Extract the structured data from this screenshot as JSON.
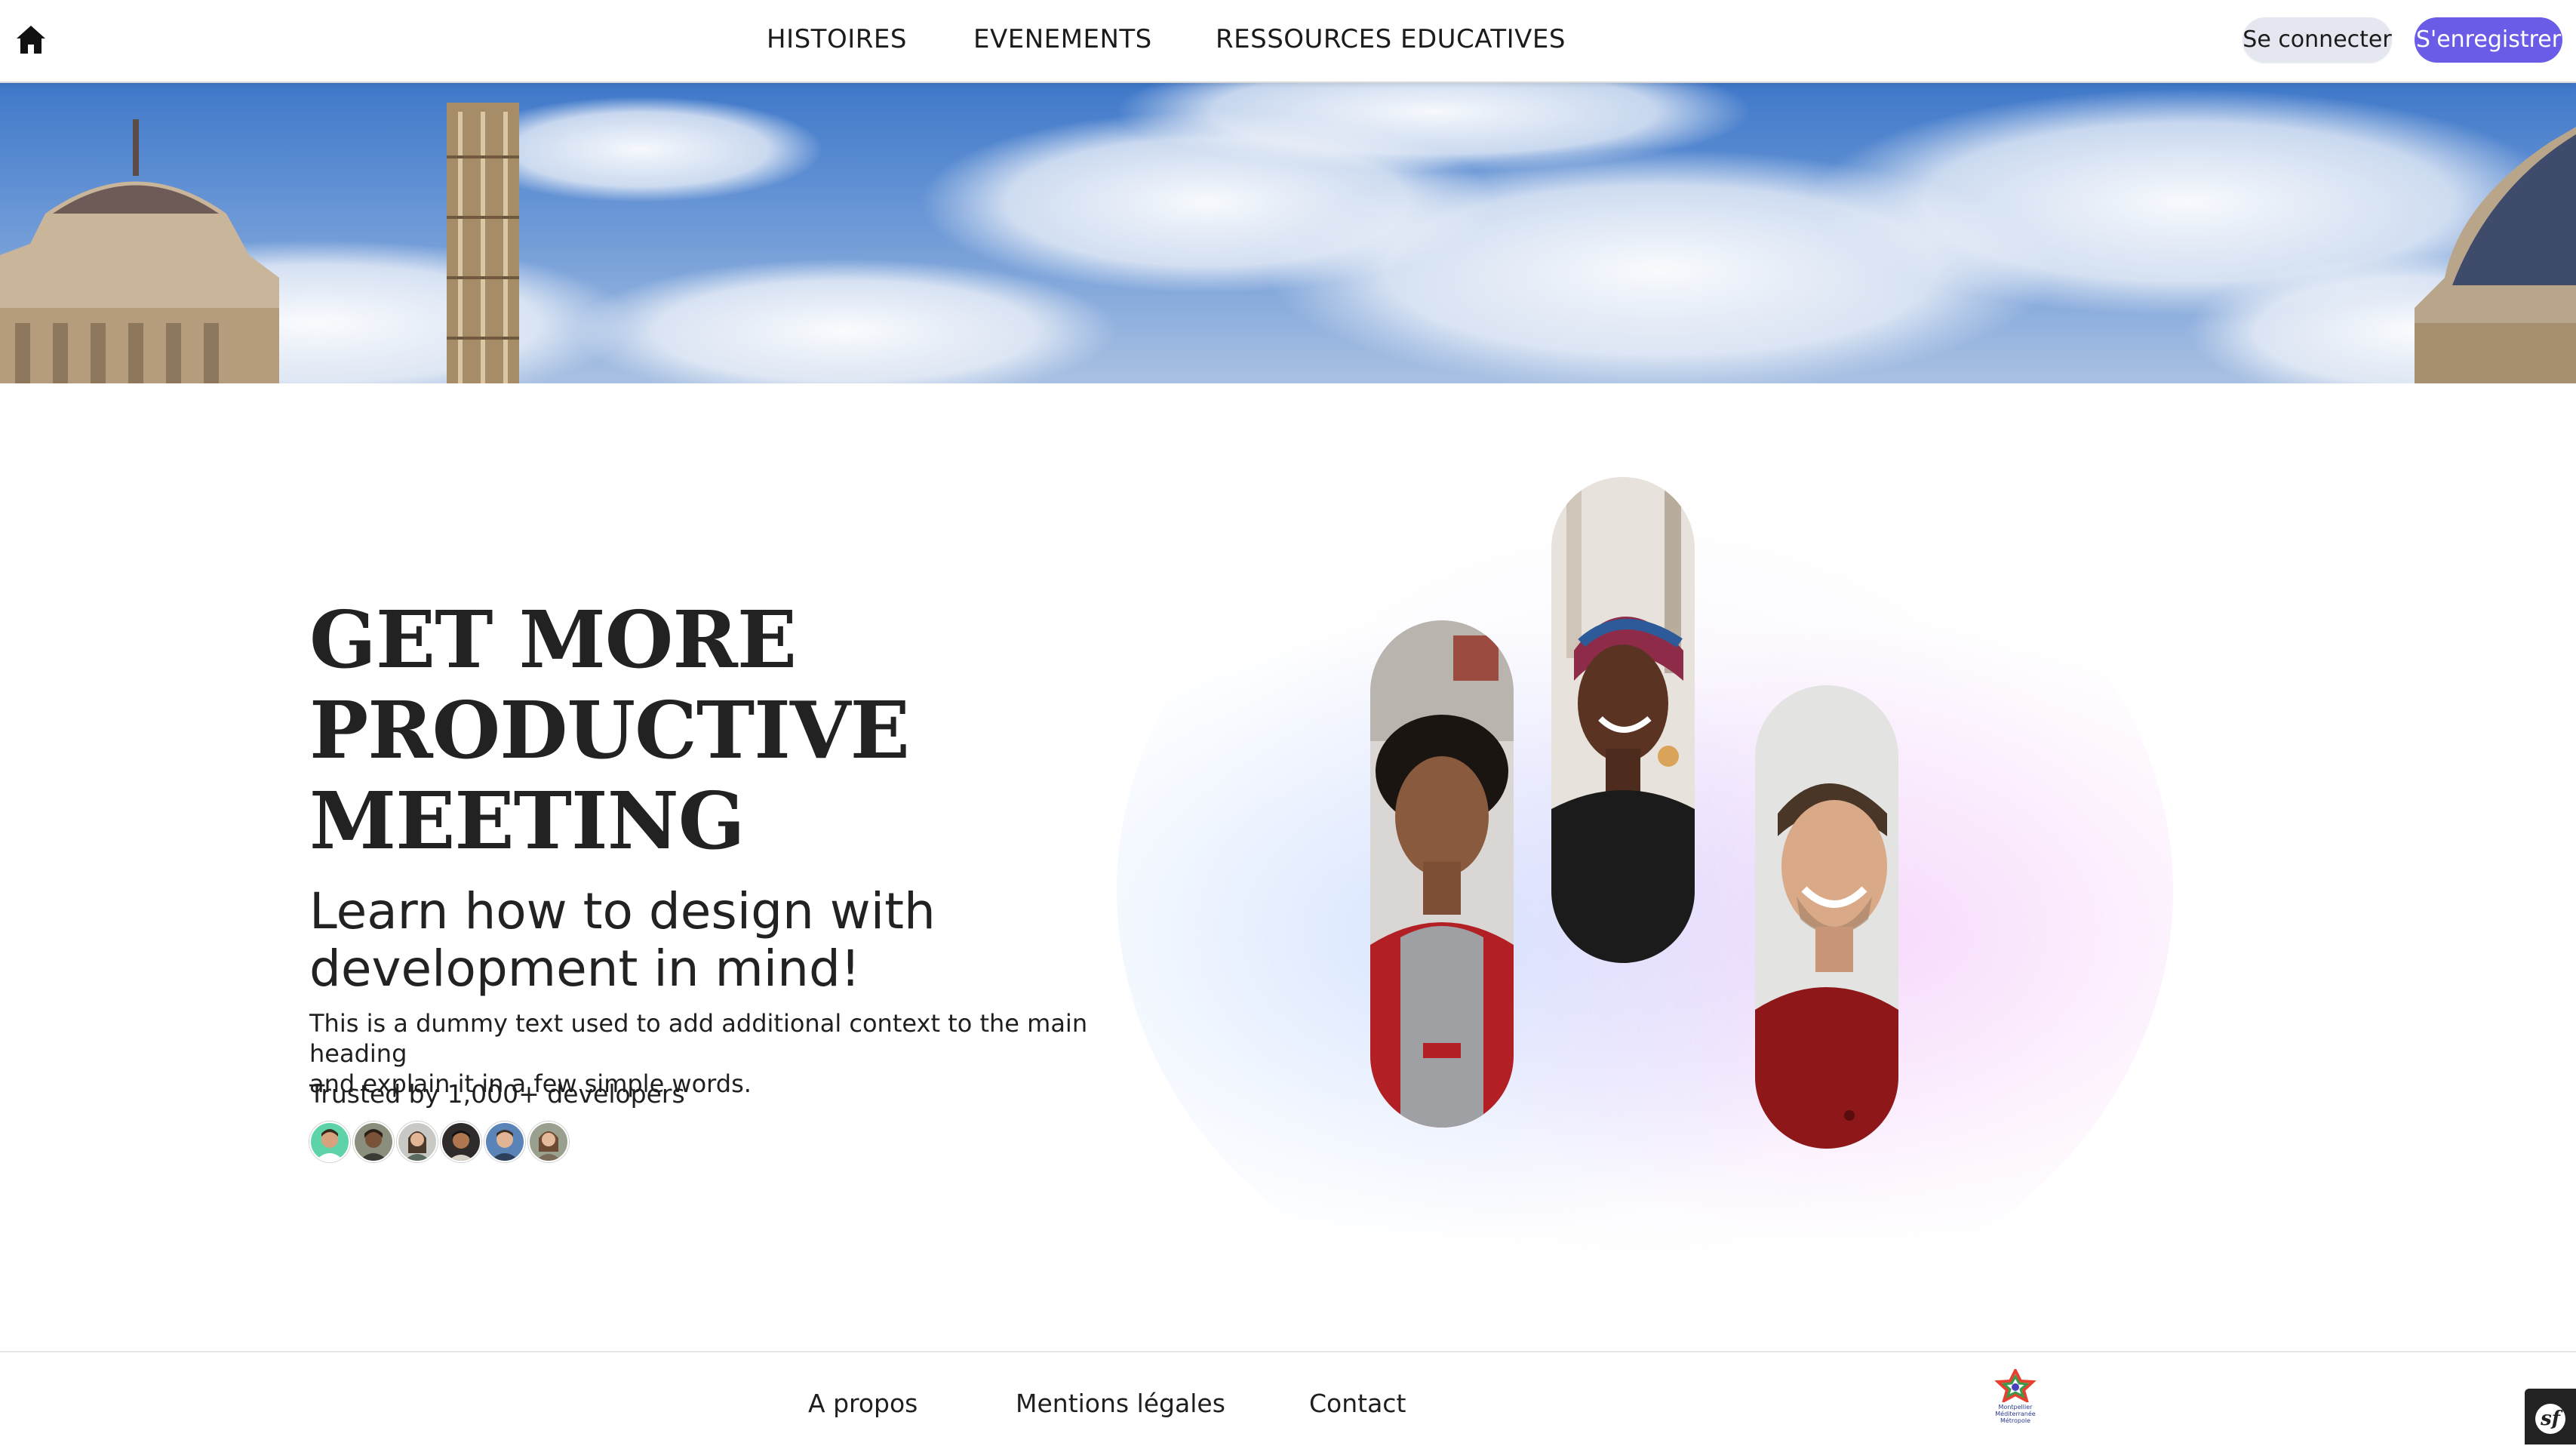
{
  "header": {
    "home_icon": "home-icon",
    "nav": [
      {
        "label": "HISTOIRES"
      },
      {
        "label": "EVENEMENTS"
      },
      {
        "label": "RESSOURCES EDUCATIVES"
      }
    ],
    "login_label": "Se connecter",
    "register_label": "S'enregistrer"
  },
  "banner": {
    "image": "city-buildings-and-cloudy-sky"
  },
  "hero": {
    "title_lines": [
      "GET MORE",
      "PRODUCTIVE",
      "MEETING"
    ],
    "subtitle_lines": [
      "Learn how to design with",
      "development in mind!"
    ],
    "description_lines": [
      "This is a dummy text used to add additional context to the main heading",
      "and explain it in a few simple words."
    ],
    "trust_text": "Trusted by 1,000+ developers",
    "avatars": [
      {
        "name": "developer-avatar-1",
        "bg": "#5fd3a8",
        "skin": "#d9a27e",
        "hair": "#3a2a1e"
      },
      {
        "name": "developer-avatar-2",
        "bg": "#8a8f7d",
        "skin": "#7a5238",
        "hair": "#2b2018"
      },
      {
        "name": "developer-avatar-3",
        "bg": "#c8c8c4",
        "skin": "#e2b595",
        "hair": "#4b3a2c"
      },
      {
        "name": "developer-avatar-4",
        "bg": "#2f2b2b",
        "skin": "#b07650",
        "hair": "#151212"
      },
      {
        "name": "developer-avatar-5",
        "bg": "#5a83b8",
        "skin": "#e0b494",
        "hair": "#3d2d22"
      },
      {
        "name": "developer-avatar-6",
        "bg": "#9aa08e",
        "skin": "#e6bb9c",
        "hair": "#6d4a33"
      }
    ],
    "portraits": [
      "portrait-young-man",
      "portrait-smiling-woman",
      "portrait-smiling-man"
    ]
  },
  "footer": {
    "links": [
      {
        "label": "A propos"
      },
      {
        "label": "Mentions légales"
      },
      {
        "label": "Contact"
      }
    ],
    "logo_lines": [
      "Montpellier",
      "Méditerranée",
      "Métropole"
    ],
    "toolbar_icon": "symfony-icon"
  },
  "colors": {
    "accent": "#6b5ce7",
    "login_bg": "#e4e7ef",
    "title": "#222222"
  }
}
